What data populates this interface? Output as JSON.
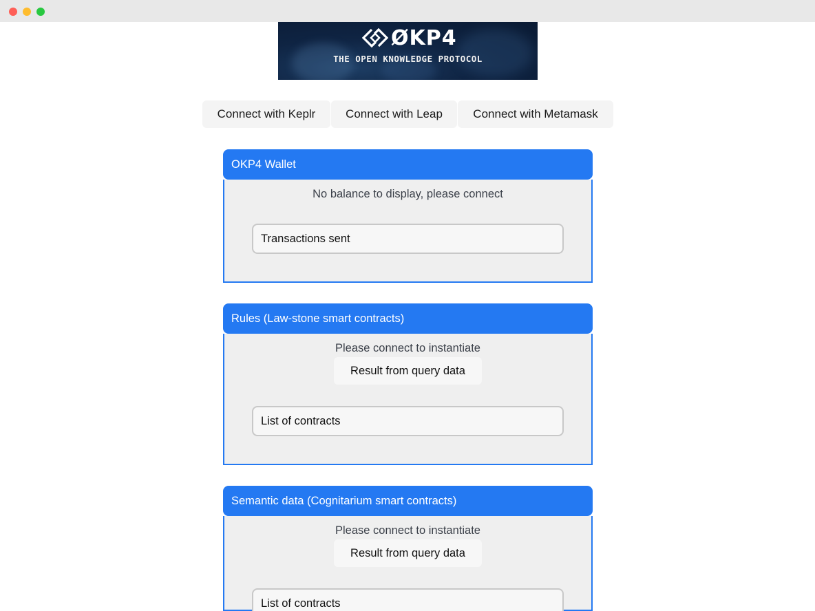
{
  "banner": {
    "title": "ØKP4",
    "subtitle": "THE OPEN KNOWLEDGE PROTOCOL"
  },
  "connect": {
    "keplr": "Connect with Keplr",
    "leap": "Connect with Leap",
    "metamask": "Connect with Metamask"
  },
  "wallet": {
    "title": "OKP4 Wallet",
    "status": "No balance to display, please connect",
    "transactions": "Transactions sent"
  },
  "rules": {
    "title": "Rules (Law-stone smart contracts)",
    "status": "Please connect to instantiate",
    "query_button": "Result from query data",
    "contracts": "List of contracts"
  },
  "semantic": {
    "title": "Semantic data (Cognitarium smart contracts)",
    "status": "Please connect to instantiate",
    "query_button": "Result from query data",
    "contracts": "List of contracts"
  },
  "colors": {
    "accent": "#2479f2",
    "card_background": "#efefef"
  }
}
